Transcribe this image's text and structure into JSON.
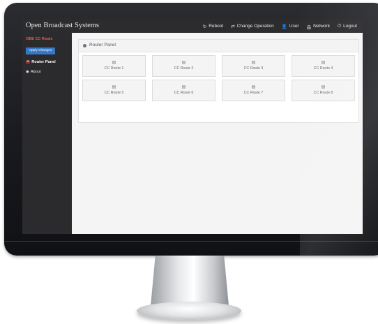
{
  "navbar": {
    "brand": "Open Broadcast Systems",
    "items": [
      {
        "id": "reboot",
        "label": "Reboot",
        "icon": "refresh-icon",
        "glyph": "↻"
      },
      {
        "id": "change-operation",
        "label": "Change Operation",
        "icon": "switch-arrows-icon",
        "glyph": "⇄"
      },
      {
        "id": "user",
        "label": "User",
        "icon": "user-icon",
        "glyph": "👤"
      },
      {
        "id": "network",
        "label": "Network",
        "icon": "network-icon",
        "glyph": "品"
      },
      {
        "id": "logout",
        "label": "Logout",
        "icon": "power-icon",
        "glyph": "⏻"
      }
    ]
  },
  "sidebar": {
    "title": "OBE CC Route",
    "apply_label": "Apply Changes",
    "items": [
      {
        "label": "Router Panel",
        "icon": "car-icon",
        "glyph": "🚘",
        "active": true
      },
      {
        "label": "About",
        "icon": "globe-icon",
        "glyph": "◉",
        "active": false
      }
    ]
  },
  "panel": {
    "title": "Router Panel",
    "routes": [
      {
        "label": "CC Route 1",
        "icon": "server-icon",
        "glyph": "▤"
      },
      {
        "label": "CC Route 2",
        "icon": "server-icon",
        "glyph": "▤"
      },
      {
        "label": "CC Route 3",
        "icon": "server-icon",
        "glyph": "▤"
      },
      {
        "label": "CC Route 4",
        "icon": "server-icon",
        "glyph": "▤"
      },
      {
        "label": "CC Route 5",
        "icon": "server-icon",
        "glyph": "▤"
      },
      {
        "label": "CC Route 6",
        "icon": "server-icon",
        "glyph": "▤"
      },
      {
        "label": "CC Route 7",
        "icon": "server-icon",
        "glyph": "▤"
      },
      {
        "label": "CC Route 8",
        "icon": "server-icon",
        "glyph": "▤"
      }
    ]
  },
  "colors": {
    "navbar_bg": "#2c2c2e",
    "sidebar_bg": "#2b2b2d",
    "sidebar_title": "#e0614d",
    "apply_button": "#3478c6"
  }
}
